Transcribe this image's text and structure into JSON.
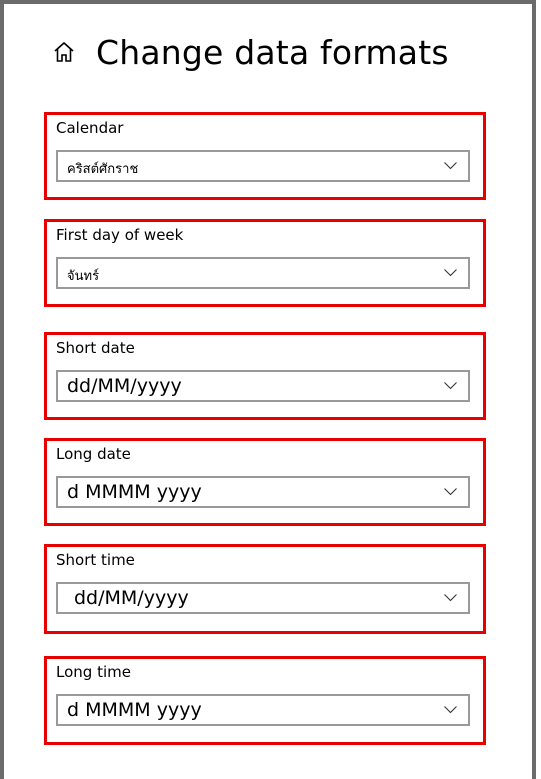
{
  "header": {
    "title": "Change data formats",
    "icon": "home-icon"
  },
  "groups": [
    {
      "label": "Calendar",
      "value": "คริสต์ศักราช"
    },
    {
      "label": "First day of week",
      "value": "จันทร์"
    },
    {
      "label": "Short date",
      "value": "dd/MM/yyyy"
    },
    {
      "label": "Long date",
      "value": "d MMMM yyyy"
    },
    {
      "label": "Short time",
      "value": "dd/MM/yyyy"
    },
    {
      "label": "Long time",
      "value": "d MMMM yyyy"
    }
  ],
  "colors": {
    "highlight_border": "#e60000",
    "dropdown_border": "#999999",
    "window_border": "#6b6b6b"
  }
}
